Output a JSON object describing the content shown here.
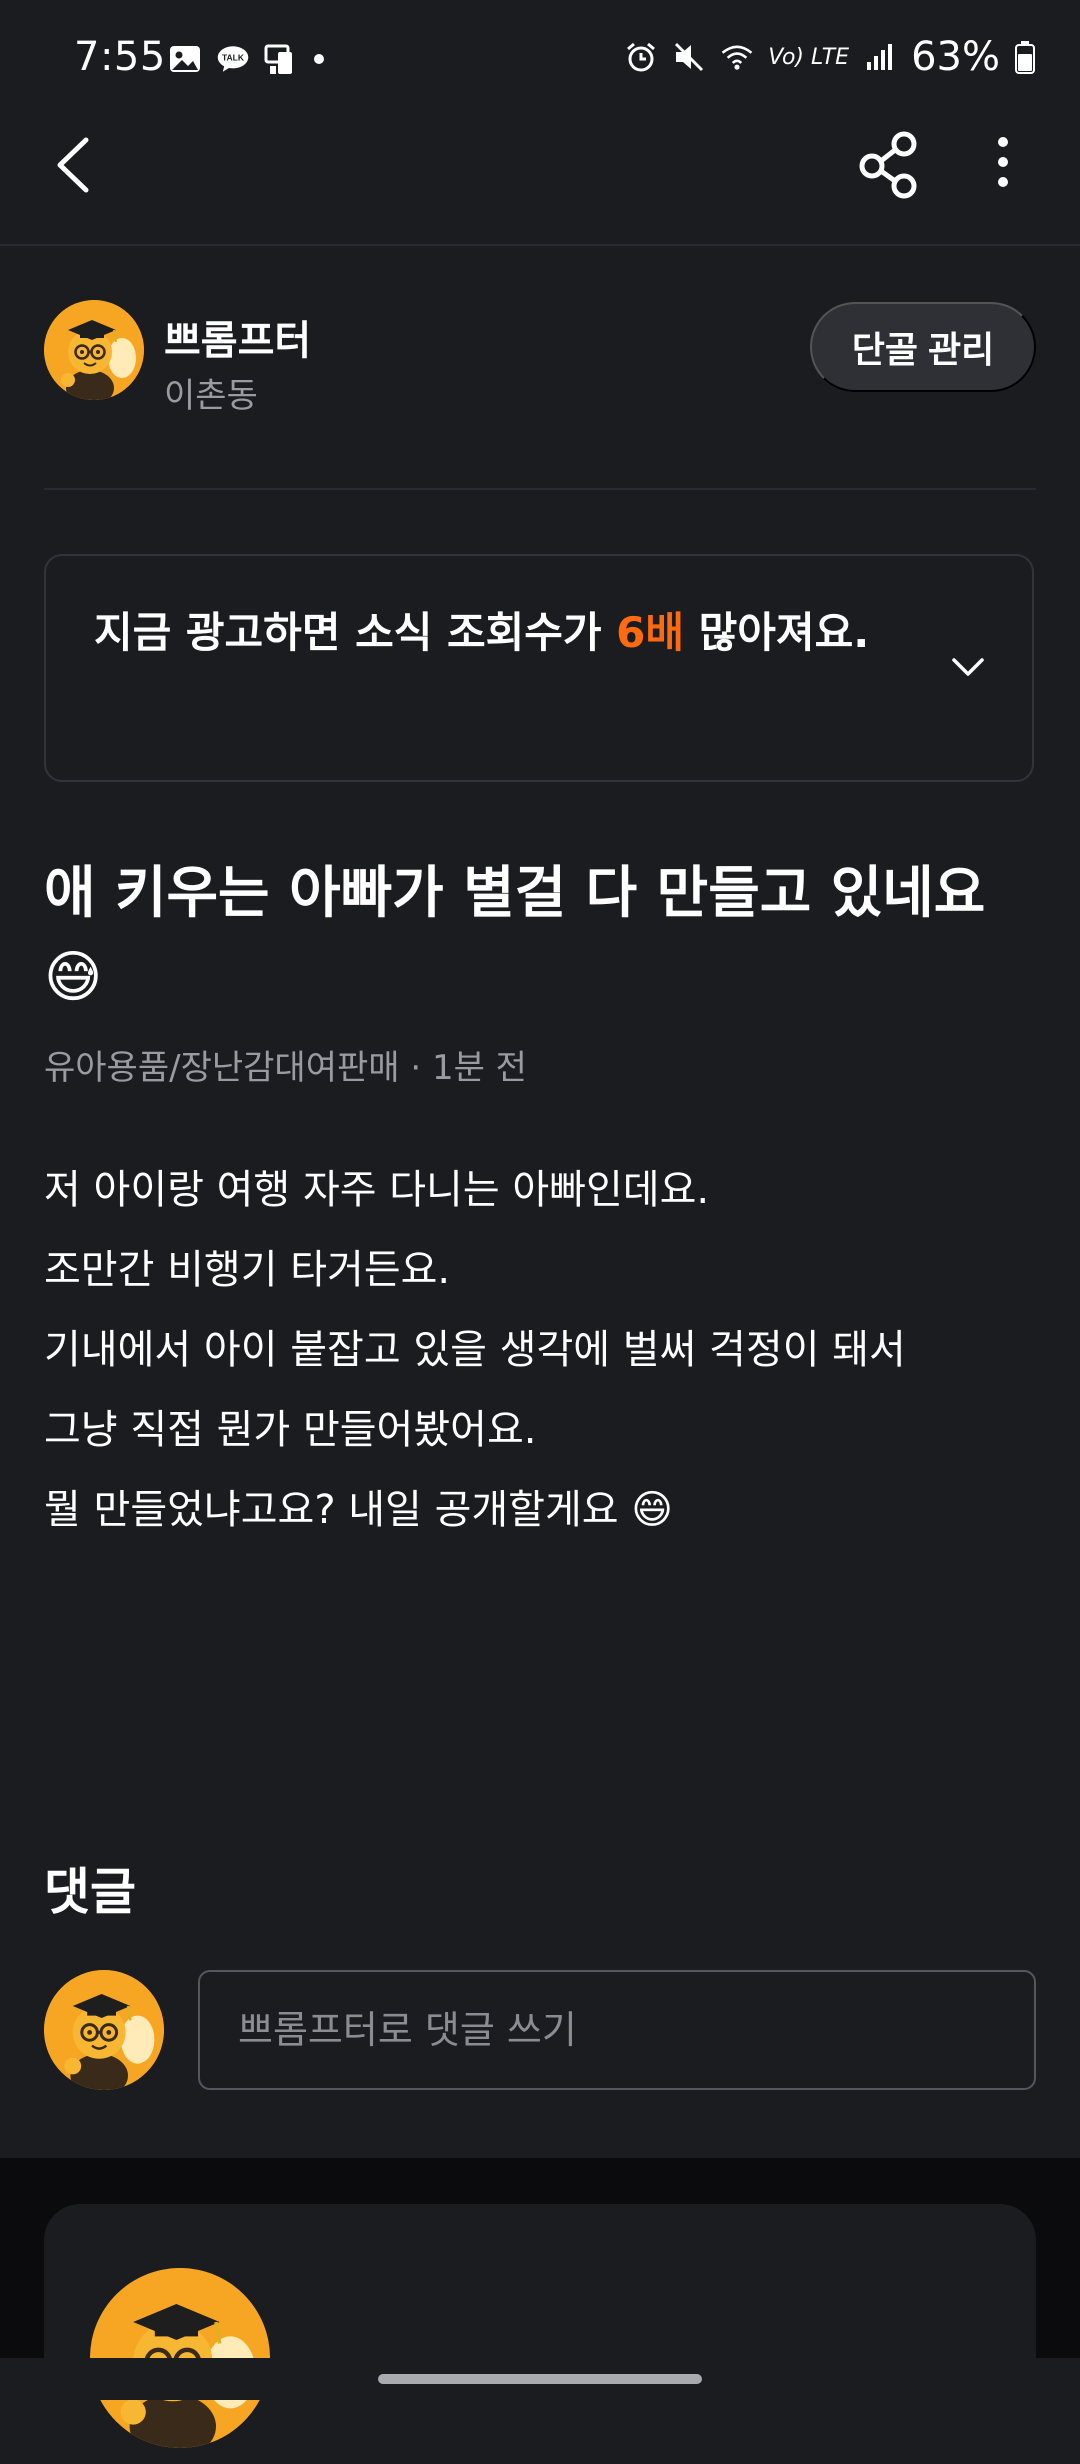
{
  "status_bar": {
    "time": "7:55",
    "network": "Vo) LTE",
    "battery_percent": "63%",
    "left_icons": [
      "gallery-icon",
      "kakaotalk-icon",
      "screen-mirror-icon",
      "dot-icon"
    ],
    "right_icons": [
      "alarm-icon",
      "mute-icon",
      "wifi-icon",
      "signal-icon",
      "battery-icon"
    ]
  },
  "topbar": {
    "icons": [
      "back-icon",
      "share-icon",
      "more-icon"
    ]
  },
  "profile": {
    "name": "쁘롬프터",
    "location": "이촌동",
    "manage_label": "단골 관리"
  },
  "ad_banner": {
    "text_before": "지금 광고하면 소식 조회수가 ",
    "highlight": "6배",
    "text_after": " 많아져요.",
    "highlight_color": "#ff6a10"
  },
  "post": {
    "title": "애 키우는 아빠가 별걸 다 만들고 있네요 😅",
    "meta": "유아용품/장난감대여판매 · 1분 전",
    "body_lines": [
      "저 아이랑 여행 자주 다니는 아빠인데요.",
      "조만간 비행기 타거든요.",
      "기내에서 아이 붙잡고 있을 생각에 벌써 걱정이 돼서",
      "그냥 직접 뭔가 만들어봤어요.",
      "뭘 만들었냐고요? 내일 공개할게요 😄"
    ]
  },
  "comments": {
    "title": "댓글",
    "input_placeholder": "쁘롬프터로 댓글 쓰기"
  },
  "colors": {
    "background": "#1b1c20",
    "accent": "#ff6a10",
    "secondary_text": "#9a9ba1",
    "avatar_orange": "#f6a623"
  }
}
